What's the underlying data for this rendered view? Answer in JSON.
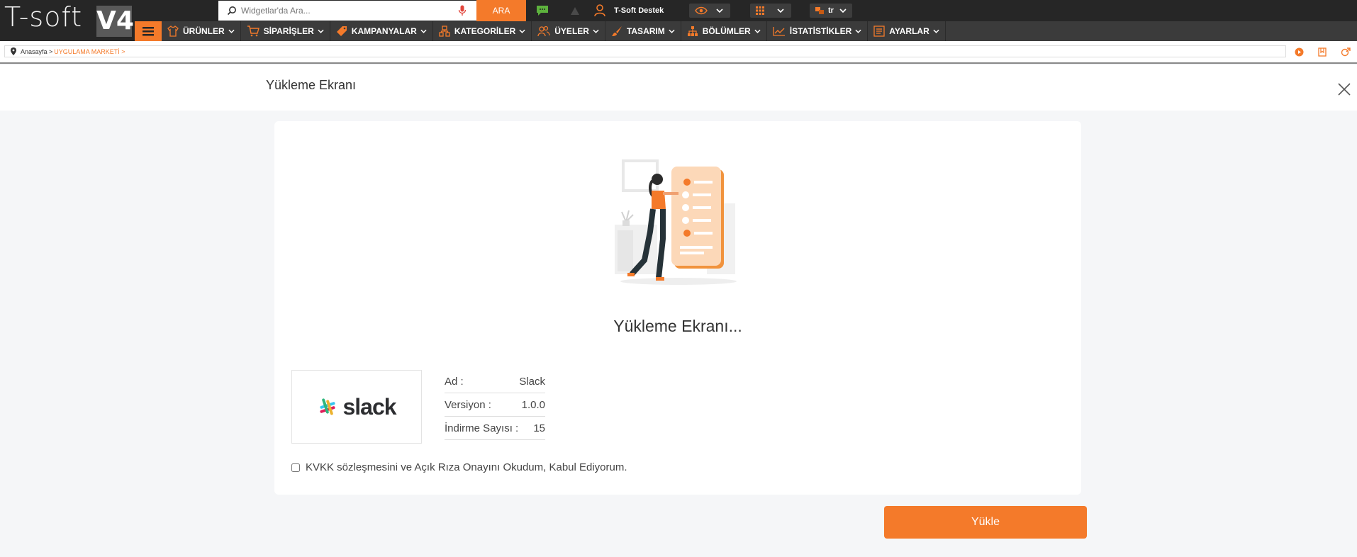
{
  "brand": {
    "logo_text": "T-soft",
    "logo_version": "V4",
    "accent": "#f47a2a"
  },
  "topbar": {
    "search_placeholder": "Widgetlar'da Ara...",
    "search_button": "ARA",
    "support_label": "T-Soft Destek",
    "language": "tr",
    "icons": [
      "search-icon",
      "microphone-icon",
      "chat-icon",
      "alert-icon",
      "user-icon",
      "eye-icon",
      "apps-icon",
      "language-icon"
    ]
  },
  "nav": {
    "items": [
      {
        "label": "ÜRÜNLER",
        "icon": "shirt-icon"
      },
      {
        "label": "SİPARİŞLER",
        "icon": "cart-icon"
      },
      {
        "label": "KAMPANYALAR",
        "icon": "tag-icon"
      },
      {
        "label": "KATEGORİLER",
        "icon": "hierarchy-icon"
      },
      {
        "label": "ÜYELER",
        "icon": "users-icon"
      },
      {
        "label": "TASARIM",
        "icon": "brush-icon"
      },
      {
        "label": "BÖLÜMLER",
        "icon": "sitemap-icon"
      },
      {
        "label": "İSTATİSTİKLER",
        "icon": "chart-icon"
      },
      {
        "label": "AYARLAR",
        "icon": "settings-list-icon"
      }
    ]
  },
  "breadcrumb": {
    "home": "Anasayfa >",
    "current": "UYGULAMA MARKETİ >"
  },
  "modal": {
    "title": "Yükleme Ekranı",
    "heading": "Yükleme Ekranı...",
    "app": {
      "logo_word": "slack",
      "rows": [
        {
          "label": "Ad :",
          "value": "Slack"
        },
        {
          "label": "Versiyon :",
          "value": "1.0.0"
        },
        {
          "label": "İndirme Sayısı :",
          "value": "15"
        }
      ]
    },
    "kvkk_label": "KVKK sözleşmesini ve Açık Rıza Onayını Okudum, Kabul Ediyorum.",
    "install_button": "Yükle"
  }
}
